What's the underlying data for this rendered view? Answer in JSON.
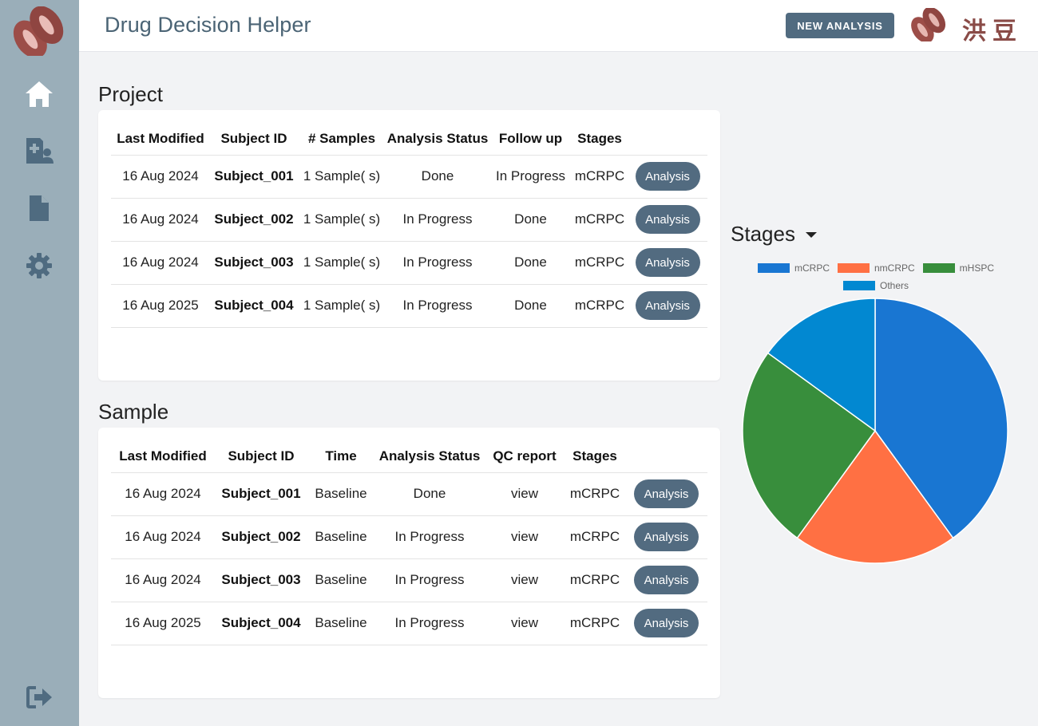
{
  "app": {
    "title": "Drug Decision Helper",
    "brand_text": "洪豆"
  },
  "header": {
    "new_analysis_label": "NEW ANALYSIS"
  },
  "sidebar": {
    "items": [
      {
        "name": "home-icon"
      },
      {
        "name": "patient-icon"
      },
      {
        "name": "document-icon"
      },
      {
        "name": "settings-icon"
      }
    ],
    "logout": {
      "name": "logout-icon"
    }
  },
  "project": {
    "title": "Project",
    "headers": [
      "Last Modified",
      "Subject ID",
      "# Samples",
      "Analysis Status",
      "Follow up",
      "Stages",
      ""
    ],
    "action_label": "Analysis",
    "rows": [
      {
        "last_modified": "16 Aug 2024",
        "subject_id": "Subject_001",
        "samples": "1 Sample( s)",
        "status": "Done",
        "follow_up": "In Progress",
        "stage": "mCRPC"
      },
      {
        "last_modified": "16 Aug 2024",
        "subject_id": "Subject_002",
        "samples": "1 Sample( s)",
        "status": "In Progress",
        "follow_up": "Done",
        "stage": "mCRPC"
      },
      {
        "last_modified": "16 Aug 2024",
        "subject_id": "Subject_003",
        "samples": "1 Sample( s)",
        "status": "In Progress",
        "follow_up": "Done",
        "stage": "mCRPC"
      },
      {
        "last_modified": "16 Aug 2025",
        "subject_id": "Subject_004",
        "samples": "1 Sample( s)",
        "status": "In Progress",
        "follow_up": "Done",
        "stage": "mCRPC"
      }
    ]
  },
  "sample": {
    "title": "Sample",
    "headers": [
      "Last Modified",
      "Subject ID",
      "Time",
      "Analysis Status",
      "QC report",
      "Stages",
      ""
    ],
    "action_label": "Analysis",
    "rows": [
      {
        "last_modified": "16 Aug 2024",
        "subject_id": "Subject_001",
        "time": "Baseline",
        "status": "Done",
        "qc": "view",
        "stage": "mCRPC"
      },
      {
        "last_modified": "16 Aug 2024",
        "subject_id": "Subject_002",
        "time": "Baseline",
        "status": "In Progress",
        "qc": "view",
        "stage": "mCRPC"
      },
      {
        "last_modified": "16 Aug 2024",
        "subject_id": "Subject_003",
        "time": "Baseline",
        "status": "In Progress",
        "qc": "view",
        "stage": "mCRPC"
      },
      {
        "last_modified": "16 Aug 2025",
        "subject_id": "Subject_004",
        "time": "Baseline",
        "status": "In Progress",
        "qc": "view",
        "stage": "mCRPC"
      }
    ]
  },
  "stages_selector": {
    "label": "Stages"
  },
  "chart_data": {
    "type": "pie",
    "title": "",
    "categories": [
      "mCRPC",
      "nmCRPC",
      "mHSPC",
      "Others"
    ],
    "values": [
      40,
      20,
      25,
      15
    ],
    "colors": [
      "#1976d2",
      "#ff7043",
      "#388e3c",
      "#0288d1"
    ],
    "legend_position": "top"
  },
  "colors": {
    "sidebar": "#9aaeb9",
    "accent": "#516b80",
    "icon": "#4f6b80",
    "brand": "#8a4b47"
  }
}
